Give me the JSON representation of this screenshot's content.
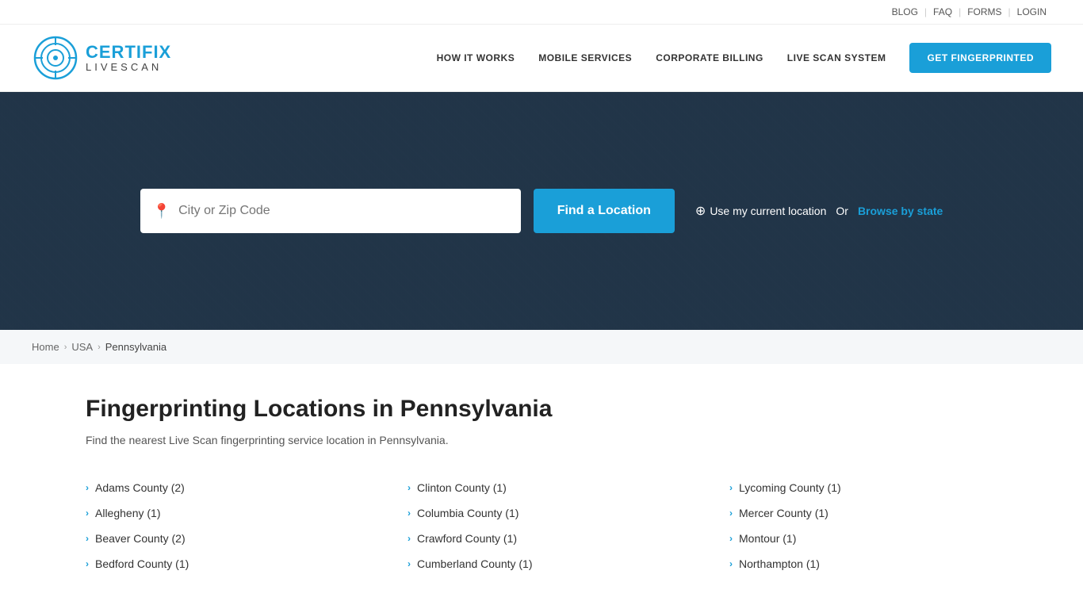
{
  "topbar": {
    "links": [
      "BLOG",
      "FAQ",
      "FORMS",
      "LOGIN"
    ]
  },
  "header": {
    "logo": {
      "certifix": "CERTIFIX",
      "livescan": "LIVESCAN"
    },
    "nav": [
      {
        "label": "HOW IT WORKS",
        "id": "how-it-works"
      },
      {
        "label": "MOBILE SERVICES",
        "id": "mobile-services"
      },
      {
        "label": "CORPORATE BILLING",
        "id": "corporate-billing"
      },
      {
        "label": "LIVE SCAN SYSTEM",
        "id": "live-scan-system"
      }
    ],
    "cta": "GET FINGERPRINTED"
  },
  "hero": {
    "search_placeholder": "City or Zip Code",
    "find_button": "Find a Location",
    "use_location": "Use my current location",
    "or_text": "Or",
    "browse_state": "Browse by state"
  },
  "breadcrumb": {
    "items": [
      "Home",
      "USA",
      "Pennsylvania"
    ]
  },
  "main": {
    "title": "Fingerprinting Locations in Pennsylvania",
    "description": "Find the nearest Live Scan fingerprinting service location in Pennsylvania.",
    "columns": [
      {
        "counties": [
          {
            "name": "Adams County",
            "count": 2
          },
          {
            "name": "Allegheny",
            "count": 1
          },
          {
            "name": "Beaver County",
            "count": 2
          },
          {
            "name": "Bedford County",
            "count": 1
          }
        ]
      },
      {
        "counties": [
          {
            "name": "Clinton County",
            "count": 1
          },
          {
            "name": "Columbia County",
            "count": 1
          },
          {
            "name": "Crawford County",
            "count": 1
          },
          {
            "name": "Cumberland County",
            "count": 1
          }
        ]
      },
      {
        "counties": [
          {
            "name": "Lycoming County",
            "count": 1
          },
          {
            "name": "Mercer County",
            "count": 1
          },
          {
            "name": "Montour",
            "count": 1
          },
          {
            "name": "Northampton",
            "count": 1
          }
        ]
      }
    ]
  }
}
